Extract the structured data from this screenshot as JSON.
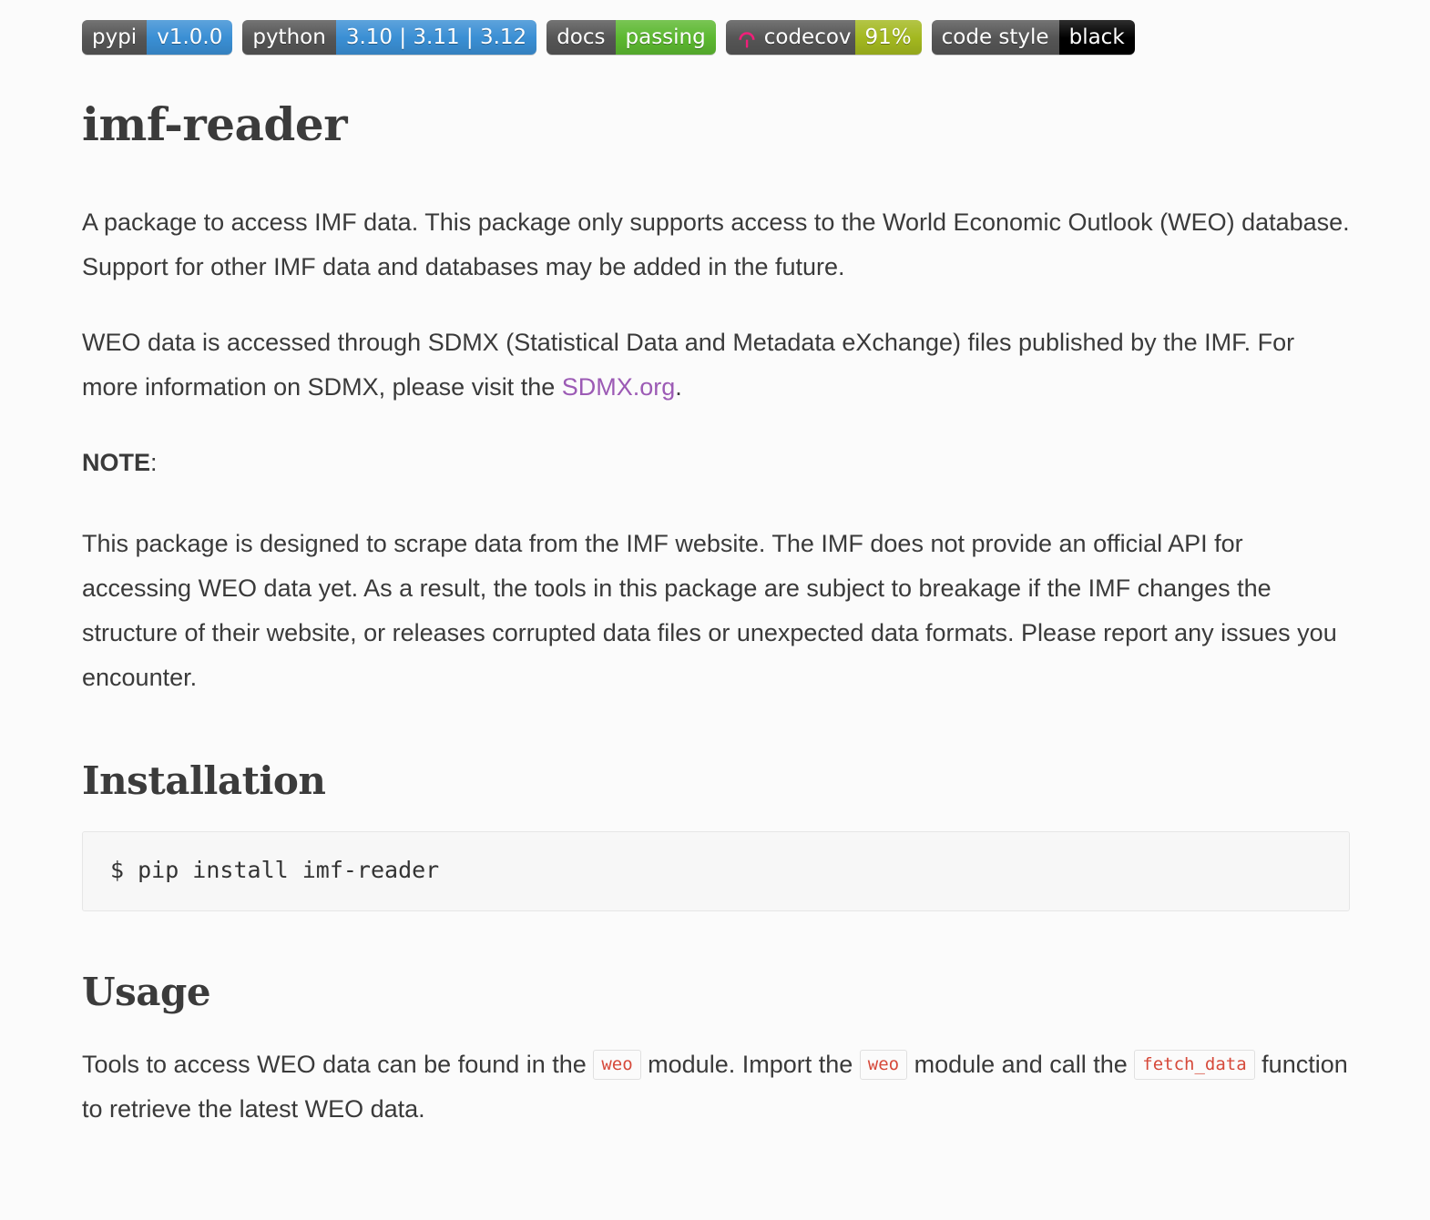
{
  "badges": [
    {
      "name": "pypi-version-badge",
      "left_label": "pypi",
      "right_label": "v1.0.0",
      "right_color": "#3a8fd4",
      "right_style": "blue",
      "icon": null
    },
    {
      "name": "python-versions-badge",
      "left_label": "python",
      "right_label": "3.10 | 3.11 | 3.12",
      "right_color": "#3a8fd4",
      "right_style": "blue",
      "icon": null
    },
    {
      "name": "docs-status-badge",
      "left_label": "docs",
      "right_label": "passing",
      "right_color": "#5cb830",
      "right_style": "green",
      "icon": null
    },
    {
      "name": "codecov-badge",
      "left_label": "codecov",
      "right_label": "91%",
      "right_color": "#a3b81f",
      "right_style": "olive",
      "icon": "codecov-umbrella-icon",
      "icon_color": "#F01F7A"
    },
    {
      "name": "code-style-badge",
      "left_label": "code style",
      "right_label": "black",
      "right_color": "#000000",
      "right_style": "black",
      "icon": null
    }
  ],
  "document": {
    "title": "imf-reader",
    "intro": {
      "text": "A package to access IMF data. This package only supports access to the World Economic Outlook (WEO) database. Support for other IMF data and databases may be added in the future."
    },
    "sdmx_paragraph": {
      "before_link": "WEO data is accessed through SDMX (Statistical Data and Metadata eXchange) files published by the IMF. For more information on SDMX, please visit the ",
      "link_text": "SDMX.org",
      "link_color": "#9c5bb5",
      "after_link": "."
    },
    "note": {
      "label": "NOTE",
      "colon": ":",
      "text": "This package is designed to scrape data from the IMF website. The IMF does not provide an official API for accessing WEO data yet. As a result, the tools in this package are subject to breakage if the IMF changes the structure of their website, or releases corrupted data files or unexpected data formats. Please report any issues you encounter."
    },
    "installation": {
      "heading": "Installation",
      "command": "$ pip install imf-reader"
    },
    "usage": {
      "heading": "Usage",
      "line_part_1": "Tools to access WEO data can be found in the ",
      "code_1": "weo",
      "line_part_2": " module. Import the ",
      "code_2": "weo",
      "line_part_3": " module and call the ",
      "code_3": "fetch_data",
      "line_part_4": " function to retrieve the latest WEO data."
    }
  }
}
